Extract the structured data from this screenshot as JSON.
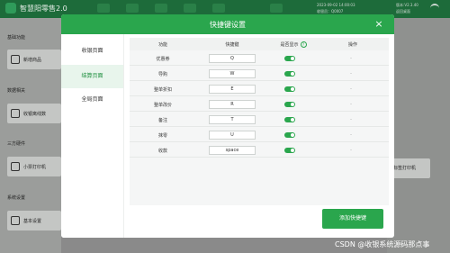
{
  "app": {
    "name": "智慧阳零售2.0",
    "header_info": [
      "2023-09-02 14:00:03",
      "收银员：Q0007",
      "版本:V2.3.40",
      "返回桌面"
    ],
    "accent": "#2aa64d"
  },
  "sidebar_bg": {
    "sections": [
      {
        "title": "基础功能",
        "item": "新增商品"
      },
      {
        "title": "数据相关",
        "item": "收银离线数"
      },
      {
        "title": "三方硬件",
        "item": "小票打印机"
      },
      {
        "title": "系统设置",
        "item": "基本设置"
      }
    ],
    "right_button": "标签打印机"
  },
  "modal": {
    "title": "快捷键设置",
    "close_icon": "×",
    "tabs": [
      {
        "label": "收银页面",
        "active": false
      },
      {
        "label": "结算页面",
        "active": true
      },
      {
        "label": "全局页面",
        "active": false
      }
    ],
    "columns": [
      "功能",
      "快捷键",
      "是否显示",
      "操作"
    ],
    "help_icon": "?",
    "rows": [
      {
        "func": "优惠券",
        "key": "Q",
        "show": true,
        "op": "-"
      },
      {
        "func": "导购",
        "key": "W",
        "show": true,
        "op": "-"
      },
      {
        "func": "整单折扣",
        "key": "E",
        "show": true,
        "op": "-"
      },
      {
        "func": "整单改价",
        "key": "R",
        "show": true,
        "op": "-"
      },
      {
        "func": "备注",
        "key": "T",
        "show": true,
        "op": "-"
      },
      {
        "func": "抹零",
        "key": "U",
        "show": true,
        "op": "-"
      },
      {
        "func": "收款",
        "key": "space",
        "show": true,
        "op": "-"
      }
    ],
    "add_button": "添加快捷键"
  },
  "watermark": "CSDN @收银系统源码那点事"
}
